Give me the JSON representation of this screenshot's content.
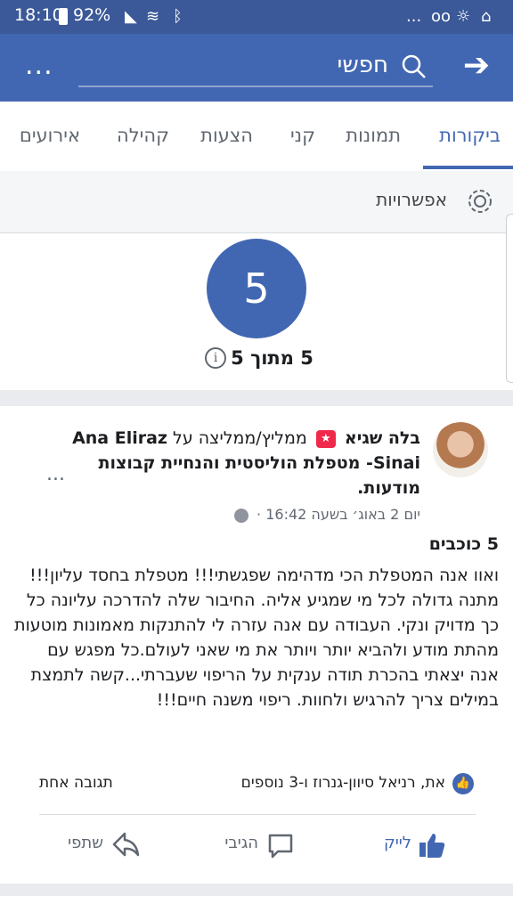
{
  "status": {
    "time": "18:10",
    "battery": "92%",
    "more": "...",
    "voicemail": "oo"
  },
  "header": {
    "search_text": "חפשי",
    "more": "...",
    "back": "➔"
  },
  "tabs": [
    {
      "label": "ביקורות"
    },
    {
      "label": "תמונות"
    },
    {
      "label": "קני"
    },
    {
      "label": "הצעות"
    },
    {
      "label": "קהילה"
    },
    {
      "label": "אירועים"
    }
  ],
  "options": {
    "label": "אפשרויות"
  },
  "rating": {
    "value": "5",
    "text": "5 מתוך 5",
    "info": "i"
  },
  "post": {
    "author": "בלה שגיא",
    "badge": "★",
    "header_rest": "ממליץ/ממליצה על",
    "page_name": "Ana Eliraz Sinai-  מטפלת הוליסטית והנחיית קבוצות מודעות.",
    "meta": "יום 2 באוג׳ בשעה 16:42 ·",
    "stars": "5 כוכבים",
    "body": "ואוו אנה המטפלת הכי מדהימה שפגשתי!!! מטפלת בחסד עליון!!! מתנה גדולה לכל מי שמגיע אליה. החיבור שלה להדרכה עליונה כל כך מדויק ונקי. העבודה עם אנה עזרה לי להתנקות מאמונות מוטעות מהתת מודע ולהביא יותר ויותר את מי שאני לעולם.כל מפגש עם אנה יצאתי בהכרת תודה ענקית על הריפוי שעברתי...קשה לתמצת במילים צריך להרגיש ולחוות. ריפוי משנה חיים!!!",
    "more": "...",
    "reactors": "את, רניאל סיוון-גנרוז ו-3 נוספים",
    "comments_count": "תגובה אחת"
  },
  "actions": {
    "like": "לייק",
    "comment": "הגיבי",
    "share": "שתפי"
  },
  "colors": {
    "brand": "#4267b2",
    "status_bar": "#3b5998",
    "badge": "#f02849"
  }
}
